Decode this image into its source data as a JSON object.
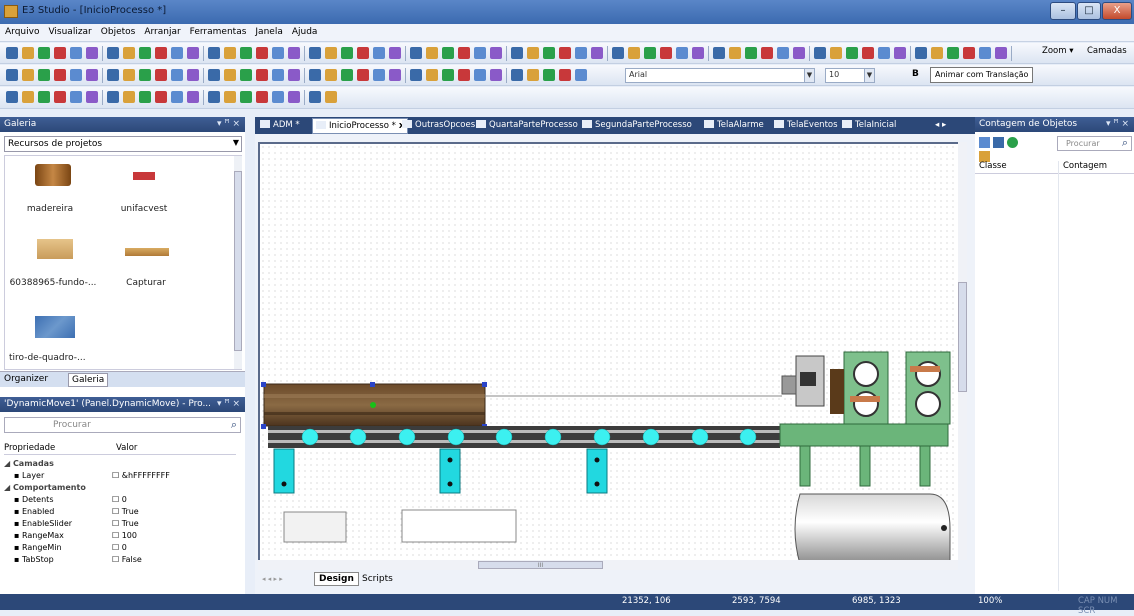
{
  "window": {
    "title": "E3 Studio - [InicioProcesso *]",
    "min": "–",
    "max": "□",
    "close": "X"
  },
  "menu": [
    "Arquivo",
    "Visualizar",
    "Objetos",
    "Arranjar",
    "Ferramentas",
    "Janela",
    "Ajuda"
  ],
  "toolbar": {
    "zoom_label": "Zoom",
    "layers_label": "Camadas",
    "font_name": "Arial",
    "font_size": "10",
    "bold": "B",
    "tooltip": "Animar com Translação"
  },
  "gallery": {
    "title": "Galeria",
    "dropdown": "Recursos de projetos",
    "items": [
      {
        "name": "madereira"
      },
      {
        "name": "unifacvest"
      },
      {
        "name": "60388965-fundo-..."
      },
      {
        "name": "Capturar"
      },
      {
        "name": "tiro-de-quadro-..."
      }
    ],
    "tabs": [
      "Organizer",
      "Galeria"
    ]
  },
  "props": {
    "title": "'DynamicMove1' (Panel.DynamicMove) - Pro...",
    "search_placeholder": "Procurar",
    "col_prop": "Propriedade",
    "col_val": "Valor",
    "groups": [
      {
        "name": "Camadas",
        "rows": [
          {
            "k": "Layer",
            "v": "&hFFFFFFFF"
          }
        ]
      },
      {
        "name": "Comportamento",
        "rows": [
          {
            "k": "Detents",
            "v": "0"
          },
          {
            "k": "Enabled",
            "v": "True"
          },
          {
            "k": "EnableSlider",
            "v": "True"
          },
          {
            "k": "RangeMax",
            "v": "100"
          },
          {
            "k": "RangeMin",
            "v": "0"
          },
          {
            "k": "TabStop",
            "v": "False"
          }
        ]
      }
    ]
  },
  "doc_tabs": [
    "ADM *",
    "InicioProcesso *",
    "OutrasOpcoes",
    "QuartaParteProcesso",
    "SegundaParteProcesso",
    "TelaAlarme",
    "TelaEventos",
    "TelaInicial"
  ],
  "active_tab": "InicioProcesso *",
  "close_tab": "x",
  "bottom_tabs": [
    "Design",
    "Scripts"
  ],
  "scroll_thumb_label": "III",
  "objcount": {
    "title": "Contagem de Objetos",
    "search_placeholder": "Procurar",
    "col_class": "Classe",
    "col_count": "Contagem"
  },
  "status": {
    "coord1": "21352, 106",
    "coord2": "2593, 7594",
    "coord3": "6985, 1323",
    "zoom": "100%",
    "caps": "CAP NUM SCR"
  }
}
